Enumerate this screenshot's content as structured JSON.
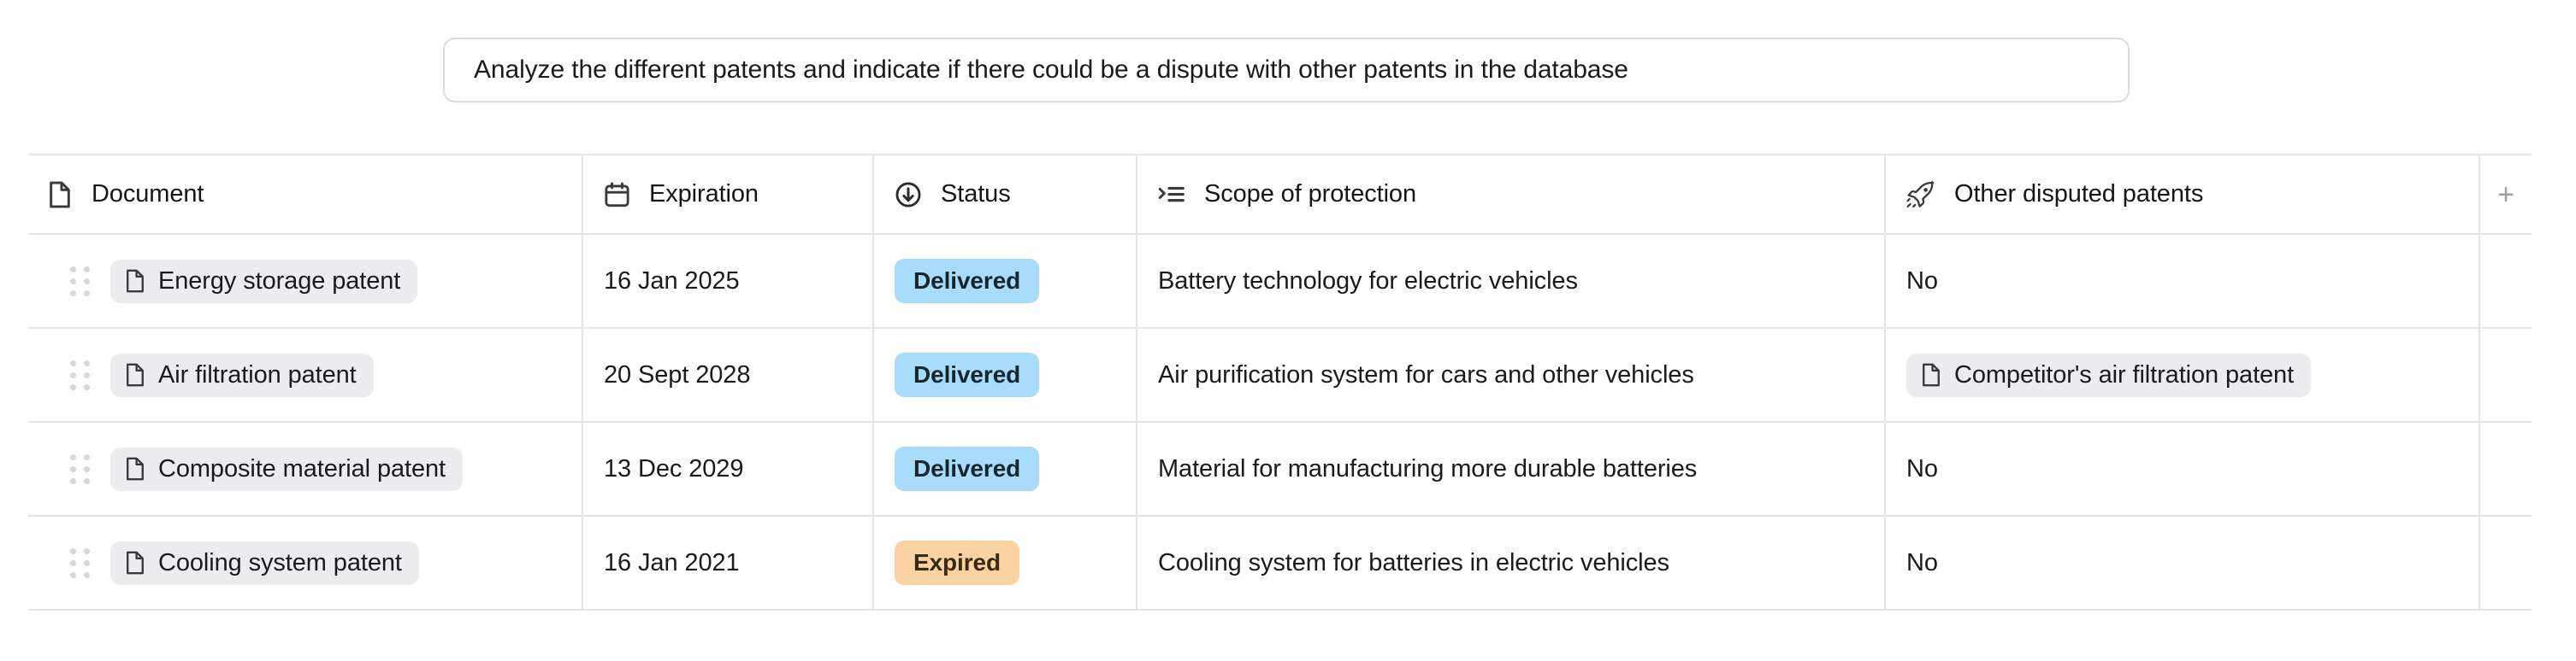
{
  "prompt": {
    "value": "Analyze the different patents and indicate if there could be a dispute with other patents in the database",
    "placeholder": "Ask anything"
  },
  "table": {
    "columns": [
      {
        "key": "document",
        "label": "Document",
        "icon": "document-icon"
      },
      {
        "key": "expiration",
        "label": "Expiration",
        "icon": "calendar-icon"
      },
      {
        "key": "status",
        "label": "Status",
        "icon": "circle-arrow-down-icon"
      },
      {
        "key": "scope",
        "label": "Scope of protection",
        "icon": "text-list-icon"
      },
      {
        "key": "other",
        "label": "Other disputed patents",
        "icon": "rocket-icon"
      }
    ],
    "add_column_label": "+",
    "rows": [
      {
        "document": "Energy storage patent",
        "expiration": "16 Jan 2025",
        "status": "Delivered",
        "status_kind": "delivered",
        "scope": "Battery technology for electric vehicles",
        "other": "No",
        "other_is_chip": false
      },
      {
        "document": "Air filtration patent",
        "expiration": "20 Sept 2028",
        "status": "Delivered",
        "status_kind": "delivered",
        "scope": "Air purification system for cars and other vehicles",
        "other": "Competitor's air filtration patent",
        "other_is_chip": true
      },
      {
        "document": "Composite material patent",
        "expiration": "13 Dec 2029",
        "status": "Delivered",
        "status_kind": "delivered",
        "scope": "Material for manufacturing more durable batteries",
        "other": "No",
        "other_is_chip": false
      },
      {
        "document": "Cooling system patent",
        "expiration": "16 Jan 2021",
        "status": "Expired",
        "status_kind": "expired",
        "scope": "Cooling system for batteries in electric vehicles",
        "other": "No",
        "other_is_chip": false
      }
    ]
  },
  "colors": {
    "badge_delivered_bg": "#a8dcfa",
    "badge_expired_bg": "#fbd3a2",
    "chip_bg": "#ececee",
    "border": "#e6e6e8",
    "text": "#1b1b1d"
  }
}
